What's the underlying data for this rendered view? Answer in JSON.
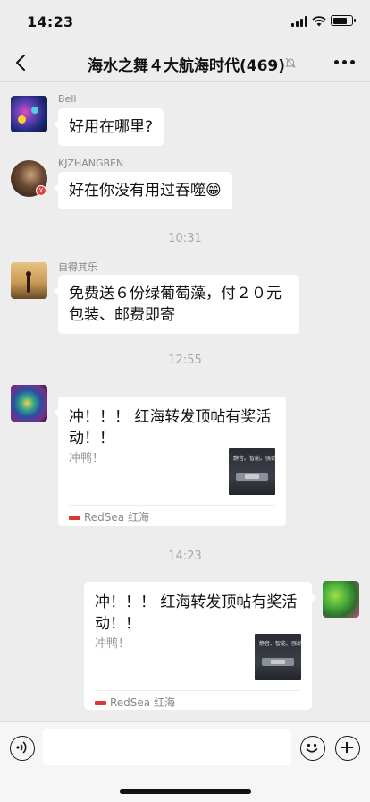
{
  "status_bar": {
    "time": "14:23",
    "battery_level": 0.8
  },
  "nav": {
    "title": "海水之舞４大航海时代(469)",
    "back_icon": "chevron-left-icon",
    "mute_icon": "bell-slash-icon",
    "more_icon": "ellipsis-icon"
  },
  "messages": [
    {
      "sender": "Bell",
      "text": "好用在哪里?"
    },
    {
      "sender": "KJZHANGBEN",
      "text": "好在你没有用过吞噬😁"
    },
    {
      "timestamp": "10:31"
    },
    {
      "sender": "自得其乐",
      "text": "免费送６份绿葡萄藻，付２０元包装、邮费即寄"
    },
    {
      "timestamp": "12:55"
    },
    {
      "sender": "",
      "card": {
        "title": "冲！！！ 红海转发顶帖有奖活动！！",
        "desc": "冲鸭！",
        "thumb_text": "静音。智能。强劲。",
        "source": "RedSea 红海"
      }
    },
    {
      "timestamp": "14:23"
    },
    {
      "sender": "me",
      "card": {
        "title": "冲！！！ 红海转发顶帖有奖活动！！",
        "desc": "冲鸭！",
        "thumb_text": "静音。智能。强劲。",
        "source": "RedSea 红海"
      }
    }
  ],
  "input_bar": {
    "voice_icon": "voice-icon",
    "emoji_icon": "smile-icon",
    "plus_icon": "plus-circle-icon",
    "placeholder": ""
  },
  "colors": {
    "background": "#ededed",
    "bubble": "#ffffff",
    "badge": "#e64340",
    "brand_redsea": "#d43b33"
  }
}
